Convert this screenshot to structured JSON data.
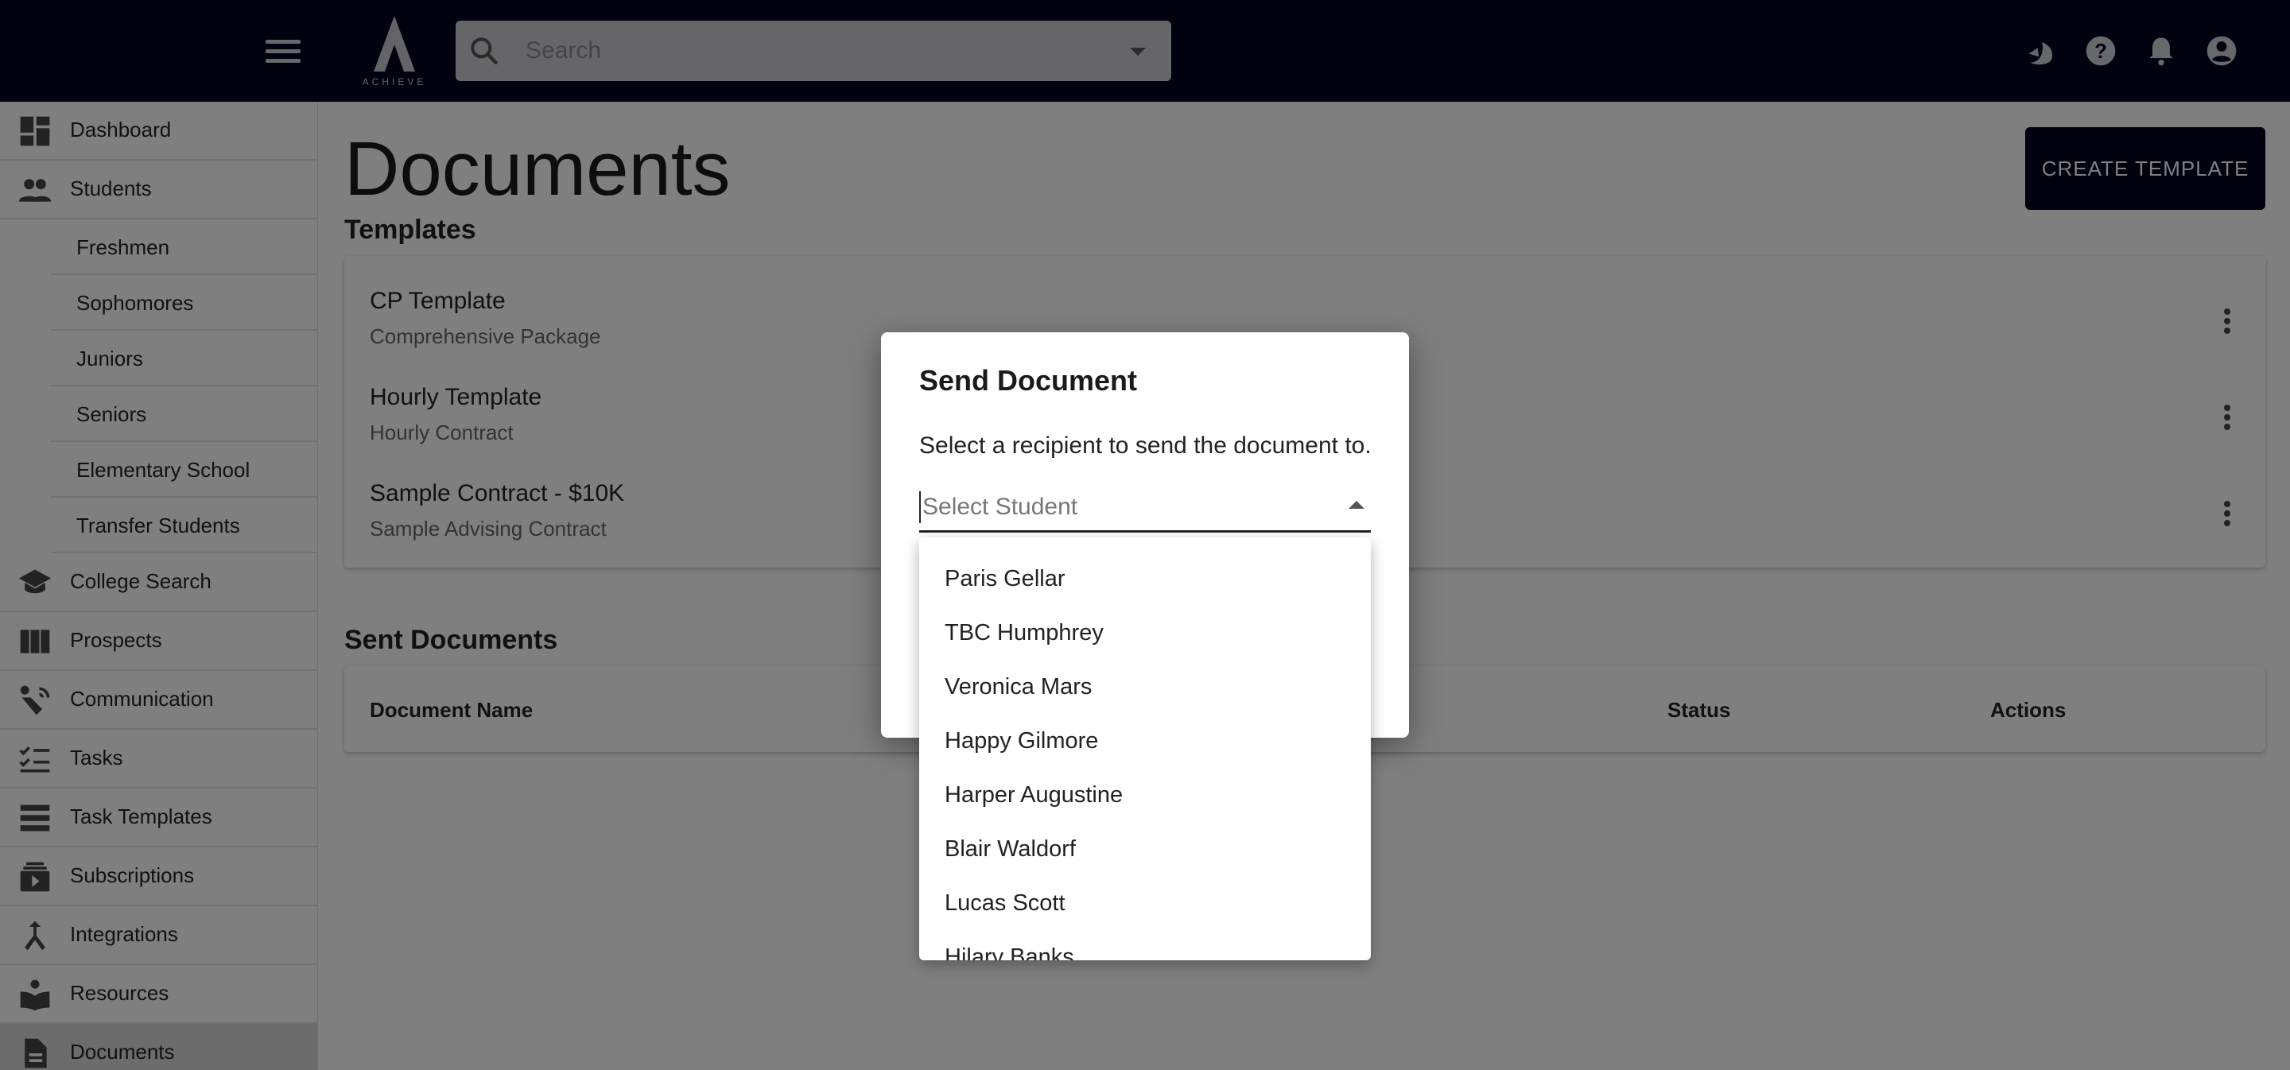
{
  "topbar": {
    "logo_text": "ACHIEVE",
    "search_placeholder": "Search"
  },
  "sidebar": {
    "items": [
      {
        "label": "Dashboard",
        "icon": "dashboard-icon"
      },
      {
        "label": "Students",
        "icon": "people-icon"
      },
      {
        "label": "College Search",
        "icon": "school-icon"
      },
      {
        "label": "Prospects",
        "icon": "columns-icon"
      },
      {
        "label": "Communication",
        "icon": "communication-icon"
      },
      {
        "label": "Tasks",
        "icon": "checklist-icon"
      },
      {
        "label": "Task Templates",
        "icon": "list-icon"
      },
      {
        "label": "Subscriptions",
        "icon": "subscriptions-icon"
      },
      {
        "label": "Integrations",
        "icon": "merge-icon"
      },
      {
        "label": "Resources",
        "icon": "book-icon"
      },
      {
        "label": "Documents",
        "icon": "document-icon"
      }
    ],
    "student_subitems": [
      "Freshmen",
      "Sophomores",
      "Juniors",
      "Seniors",
      "Elementary School",
      "Transfer Students"
    ]
  },
  "main": {
    "title": "Documents",
    "create_button": "CREATE TEMPLATE",
    "templates_title": "Templates",
    "templates": [
      {
        "name": "CP Template",
        "subtitle": "Comprehensive Package"
      },
      {
        "name": "Hourly Template",
        "subtitle": "Hourly Contract"
      },
      {
        "name": "Sample Contract - $10K",
        "subtitle": "Sample Advising Contract"
      }
    ],
    "sent_title": "Sent Documents",
    "sent_columns": {
      "name": "Document Name",
      "status": "Status",
      "actions": "Actions"
    }
  },
  "dialog": {
    "title": "Send Document",
    "text": "Select a recipient to send the document to.",
    "select_placeholder": "Select Student",
    "options": [
      "Paris Gellar",
      "TBC Humphrey",
      "Veronica Mars",
      "Happy Gilmore",
      "Harper Augustine",
      "Blair Waldorf",
      "Lucas Scott",
      "Hilary Banks"
    ]
  },
  "colors": {
    "brand_dark": "#03031f",
    "overlay": "rgba(0,0,0,0.5)"
  }
}
